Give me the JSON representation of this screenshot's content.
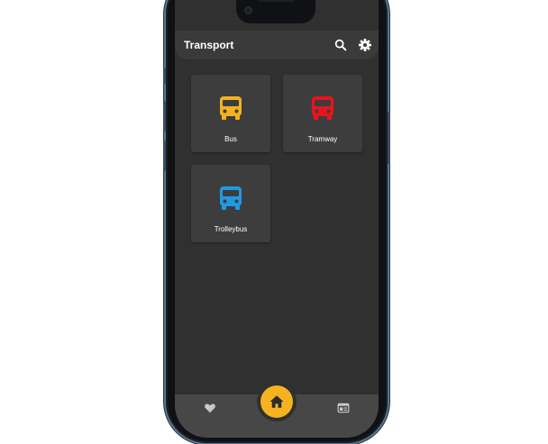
{
  "app": {
    "title": "Transport"
  },
  "appbar": {
    "search_icon": "search-icon",
    "settings_icon": "gear-icon"
  },
  "transports": [
    {
      "label": "Bus",
      "icon": "bus-icon",
      "color": "#f4b21f"
    },
    {
      "label": "Tramway",
      "icon": "bus-icon",
      "color": "#e8141c"
    },
    {
      "label": "Trolleybus",
      "icon": "bus-icon",
      "color": "#1f9ae0"
    }
  ],
  "bottom_nav": {
    "left_icon": "heart-icon",
    "center_icon": "home-icon",
    "right_icon": "news-icon",
    "accent": "#f6b21f"
  }
}
